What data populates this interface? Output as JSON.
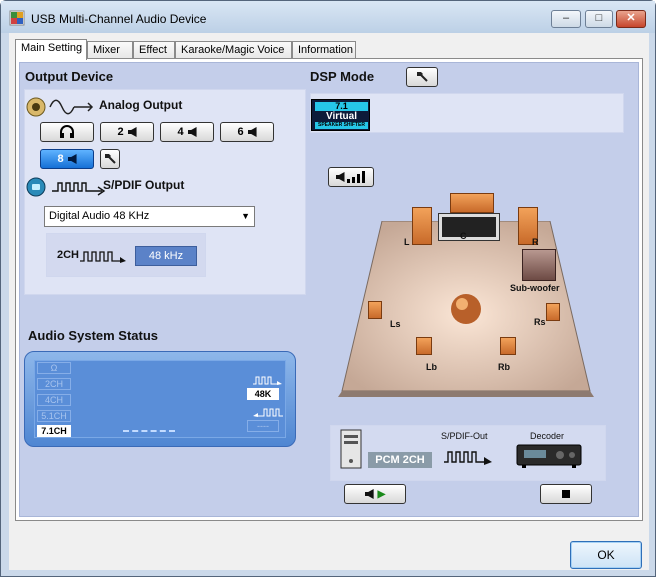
{
  "window": {
    "title": "USB Multi-Channel Audio Device",
    "minimize": "–",
    "maximize": "□",
    "close": "✕"
  },
  "tabs": [
    {
      "label": "Main Setting",
      "active": true
    },
    {
      "label": "Mixer",
      "active": false
    },
    {
      "label": "Effect",
      "active": false
    },
    {
      "label": "Karaoke/Magic Voice",
      "active": false
    },
    {
      "label": "Information",
      "active": false
    }
  ],
  "output_device": {
    "heading": "Output Device",
    "analog_label": "Analog Output",
    "channel_buttons": [
      {
        "label": "",
        "icon": "headphone-icon",
        "selected": false
      },
      {
        "label": "2",
        "selected": false
      },
      {
        "label": "4",
        "selected": false
      },
      {
        "label": "6",
        "selected": false
      },
      {
        "label": "8",
        "selected": true
      }
    ],
    "spdif_label": "S/PDIF Output",
    "spdif_select_value": "Digital Audio 48 KHz",
    "spdif_channels": "2CH",
    "spdif_rate": "48 kHz"
  },
  "audio_status": {
    "heading": "Audio System Status",
    "channels": [
      "2CH",
      "4CH",
      "5.1CH",
      "7.1CH"
    ],
    "active_channel": "7.1CH",
    "sample_rate": "48K"
  },
  "dsp": {
    "heading": "DSP Mode",
    "virtual_badge": {
      "top": "7.1",
      "mid": "Virtual",
      "bottom": "SPEAKER SHIFTER"
    },
    "speaker_labels": {
      "c": "C",
      "l": "L",
      "r": "R",
      "ls": "Ls",
      "rs": "Rs",
      "lb": "Lb",
      "rb": "Rb",
      "sub": "Sub-woofer"
    },
    "pcm_label": "PCM 2CH",
    "spdif_out_label": "S/PDIF-Out",
    "decoder_label": "Decoder"
  },
  "colors": {
    "accent": "#1670d6",
    "panel": "#c4ceea",
    "status_blue": "#5a8ed8",
    "speaker_orange": "#e08a40"
  },
  "ok_button": "OK"
}
